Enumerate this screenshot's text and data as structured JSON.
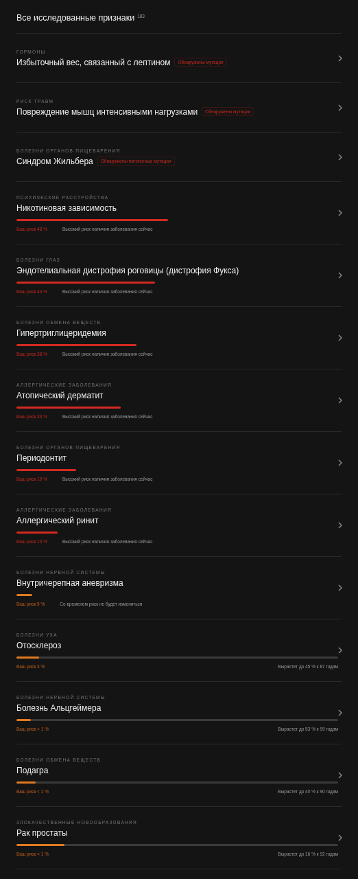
{
  "header": {
    "title": "Все исследованные признаки",
    "count": "183"
  },
  "items": [
    {
      "kind": "badge",
      "category": "ГОРМОНЫ",
      "title": "Избыточный вес, связанный с лептином",
      "badge": "Обнаружены мутации"
    },
    {
      "kind": "badge",
      "category": "РИСК ТРАВМ",
      "title": "Повреждение мышц интенсивными нагрузками",
      "badge": "Обнаружены мутации"
    },
    {
      "kind": "badge",
      "category": "БОЛЕЗНИ ОРГАНОВ ПИЩЕВАРЕНИЯ",
      "title": "Синдром Жильбера",
      "badge": "Обнаружены патогенные мутации"
    },
    {
      "kind": "high",
      "category": "ПСИХИЧЕСКИЕ РАССТРОЙСТВА",
      "title": "Никотиновая зависимость",
      "level": 0.48,
      "risk": "Ваш риск 48 %",
      "note": "Высокий риск наличия заболевания сейчас"
    },
    {
      "kind": "high",
      "category": "БОЛЕЗНИ ГЛАЗ",
      "title": "Эндотелиальная дистрофия роговицы (дистрофия Фукса)",
      "level": 0.44,
      "risk": "Ваш риск 44 %",
      "note": "Высокий риск наличия заболевания сейчас"
    },
    {
      "kind": "high",
      "category": "БОЛЕЗНИ ОБМЕНА ВЕЩЕСТВ",
      "title": "Гипертриглицеридемия",
      "level": 0.38,
      "risk": "Ваш риск 38 %",
      "note": "Высокий риск наличия заболевания сейчас"
    },
    {
      "kind": "high",
      "category": "АЛЛЕРГИЧЕСКИЕ ЗАБОЛЕВАНИЯ",
      "title": "Атопический дерматит",
      "level": 0.33,
      "risk": "Ваш риск 33 %",
      "note": "Высокий риск наличия заболевания сейчас"
    },
    {
      "kind": "high",
      "category": "БОЛЕЗНИ ОРГАНОВ ПИЩЕВАРЕНИЯ",
      "title": "Периодонтит",
      "level": 0.19,
      "risk": "Ваш риск 19 %",
      "note": "Высокий риск наличия заболевания сейчас"
    },
    {
      "kind": "high",
      "category": "АЛЛЕРГИЧЕСКИЕ ЗАБОЛЕВАНИЯ",
      "title": "Аллергический ринит",
      "level": 0.13,
      "risk": "Ваш риск 13 %",
      "note": "Высокий риск наличия заболевания сейчас"
    },
    {
      "kind": "stable",
      "category": "БОЛЕЗНИ НЕРВНОЙ СИСТЕМЫ",
      "title": "Внутричерепная аневризма",
      "level": 0.05,
      "risk": "Ваш риск 5 %",
      "note": "Со временем риск не будет изменяться"
    },
    {
      "kind": "growing",
      "category": "БОЛЕЗНИ УХА",
      "title": "Отосклероз",
      "level": 0.07,
      "risk": "Ваш риск 3 %",
      "note": "Вырастет до 45 % к 87 годам"
    },
    {
      "kind": "growing",
      "category": "БОЛЕЗНИ НЕРВНОЙ СИСТЕМЫ",
      "title": "Болезнь Альцгеймера",
      "level": 0.045,
      "risk": "Ваш риск < 1 %",
      "note": "Вырастет до 53 % к 99 годам"
    },
    {
      "kind": "growing",
      "category": "БОЛЕЗНИ ОБМЕНА ВЕЩЕСТВ",
      "title": "Подагра",
      "level": 0.06,
      "risk": "Ваш риск < 1 %",
      "note": "Вырастет до 40 % к 90 годам"
    },
    {
      "kind": "growing",
      "category": "ЗЛОКАЧЕСТВЕННЫЕ НОВООБРАЗОВАНИЯ",
      "title": "Рак простаты",
      "level": 0.15,
      "risk": "Ваш риск < 1 %",
      "note": "Вырастет до 16 % к 92 годам"
    }
  ]
}
